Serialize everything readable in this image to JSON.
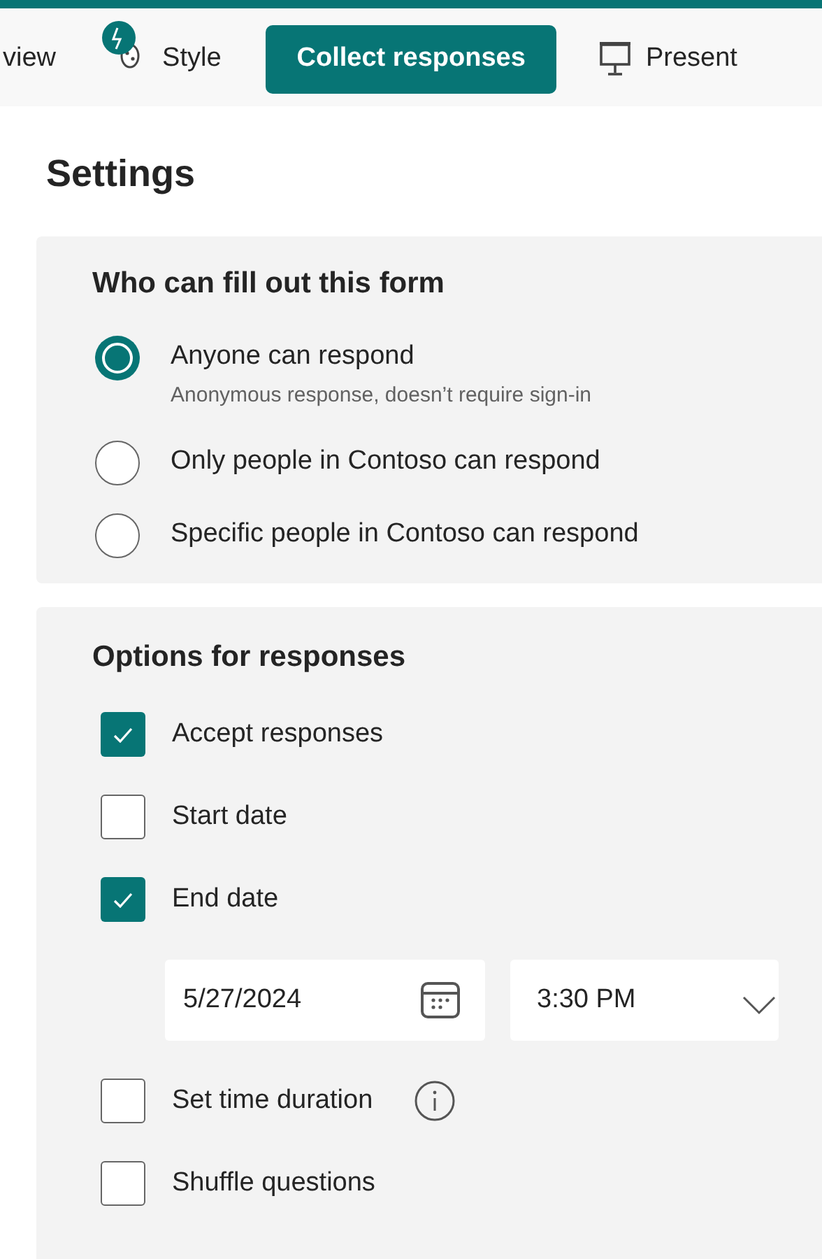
{
  "toolbar": {
    "tabs": [
      {
        "label": "view",
        "kind": "text",
        "selected": false
      },
      {
        "label": "Style",
        "kind": "style",
        "selected": false
      },
      {
        "label": "Collect responses",
        "kind": "text",
        "selected": true
      },
      {
        "label": "Present",
        "kind": "present",
        "selected": false
      }
    ]
  },
  "title": "Settings",
  "who": {
    "heading": "Who can fill out this form",
    "options": [
      {
        "label": "Anyone can respond",
        "hint": "Anonymous response, doesn’t require sign-in",
        "selected": true
      },
      {
        "label": "Only people in Contoso can respond",
        "selected": false
      },
      {
        "label": "Specific people in Contoso can respond",
        "selected": false
      }
    ]
  },
  "responses": {
    "heading": "Options for responses",
    "items": [
      {
        "kind": "checkbox",
        "label": "Accept responses",
        "checked": true
      },
      {
        "kind": "checkbox",
        "label": "Start date",
        "checked": false
      },
      {
        "kind": "checkbox",
        "label": "End date",
        "checked": true
      },
      {
        "kind": "datetime",
        "date": "5/27/2024",
        "time": "3:30 PM"
      },
      {
        "kind": "checkbox",
        "label": "Set time duration",
        "checked": false,
        "info": true
      },
      {
        "kind": "checkbox",
        "label": "Shuffle questions",
        "checked": false
      }
    ]
  }
}
